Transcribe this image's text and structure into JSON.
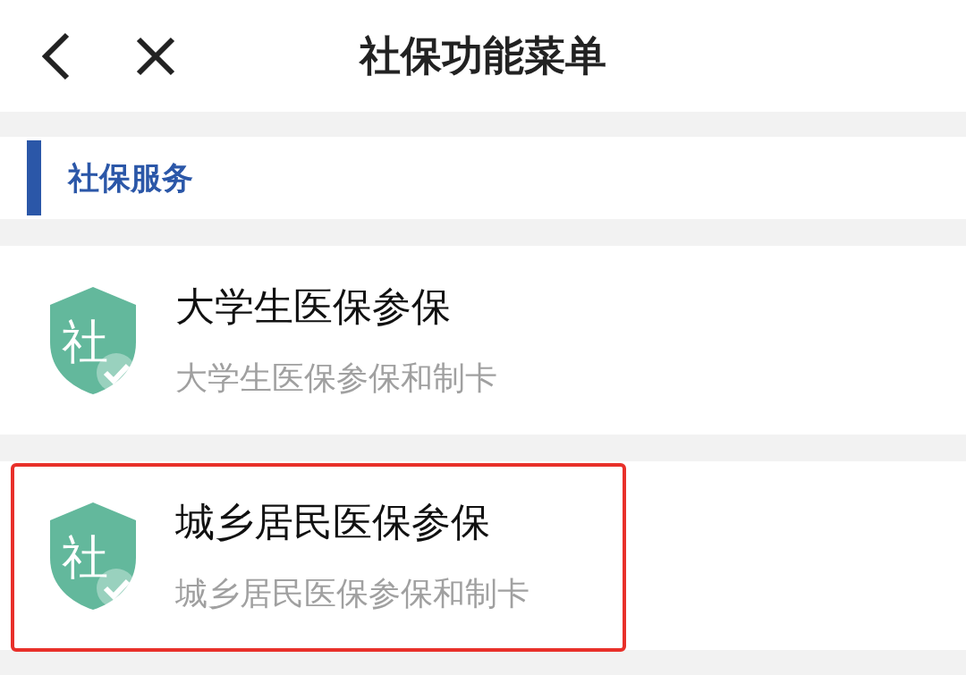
{
  "nav_bar": {
    "title": "社保功能菜单"
  },
  "section": {
    "title": "社保服务"
  },
  "items": [
    {
      "icon_glyph": "社",
      "title": "大学生医保参保",
      "subtitle": "大学生医保参保和制卡",
      "highlighted": false
    },
    {
      "icon_glyph": "社",
      "title": "城乡居民医保参保",
      "subtitle": "城乡居民医保参保和制卡",
      "highlighted": true
    }
  ]
}
